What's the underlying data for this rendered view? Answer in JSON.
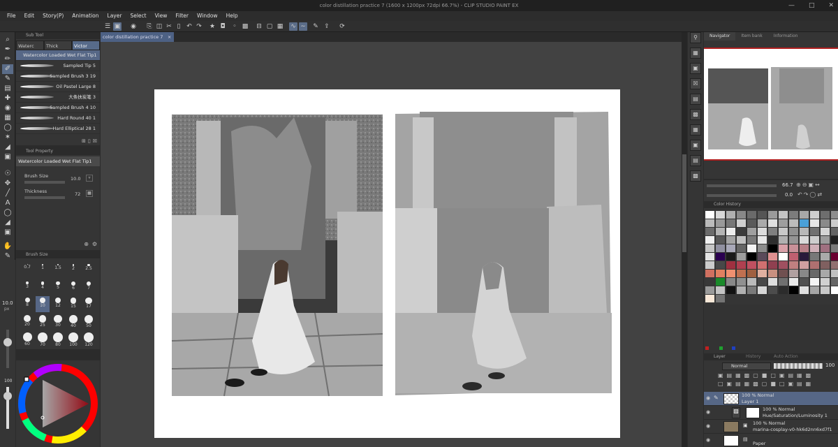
{
  "window": {
    "title": "color distillation practice 7 (1600 x 1200px 72dpi 66.7%) - CLIP STUDIO PAINT EX"
  },
  "menu": [
    "File",
    "Edit",
    "Story(P)",
    "Animation",
    "Layer",
    "Select",
    "View",
    "Filter",
    "Window",
    "Help"
  ],
  "subtool": {
    "header": "Sub Tool",
    "tabs": [
      "Waterc",
      "Thick",
      "Victor"
    ],
    "brushes": [
      "Watercolor Loaded Wet Flat Tip1",
      "Sampled Tip 5",
      "Sampled Brush 3 19",
      "Oil Pastel Large 8",
      "大条扶炭笔 3",
      "Sampled Brush 4 10",
      "Hard Round 40 1",
      "Hard Elliptical 28 1"
    ]
  },
  "tool_property": {
    "header": "Tool Property",
    "brush_name": "Watercolor Loaded Wet Flat Tip1",
    "brush_size_label": "Brush Size",
    "brush_size_value": "10.0",
    "thickness_label": "Thickness",
    "thickness_value": "72"
  },
  "brush_size": {
    "header": "Brush Size",
    "sizes": [
      "0.7",
      "1",
      "1.5",
      "2",
      "2.5",
      "3",
      "4",
      "5",
      "6",
      "7",
      "8",
      "10",
      "12",
      "15",
      "17",
      "20",
      "25",
      "30",
      "40",
      "50",
      "60",
      "70",
      "80",
      "100",
      "120"
    ],
    "selected": "10"
  },
  "left_strip": {
    "size_value": "10.0",
    "size_unit": "px",
    "opacity": "100"
  },
  "document_tab": {
    "label": "color distillation practice 7"
  },
  "navigator": {
    "tabs": [
      "Navigator",
      "Item bank",
      "Information"
    ],
    "zoom": "66.7",
    "rotation": "0.0"
  },
  "color_history": {
    "header": "Color History",
    "swatches": [
      "#ffffff",
      "#d8d8d8",
      "#b0b0b0",
      "#888888",
      "#6a6a6a",
      "#555555",
      "#9a9a9a",
      "#c4c4c4",
      "#7c7c7c",
      "#a8a8a8",
      "#cfcfcf",
      "#6e6e6e",
      "#8e8e8e",
      "#bbbbbb",
      "#999999",
      "#777777",
      "#d0d0d0",
      "#5a5a5a",
      "#aaaaaa",
      "#e0e0e0",
      "#9e9e9e",
      "#bcbcbc",
      "#4aa0d8",
      "#e6e6e6",
      "#8a8a8a",
      "#cccccc",
      "#6c6c6c",
      "#b4b4b4",
      "#ededed",
      "#3c3c3c",
      "#a0a0a0",
      "#dcdcdc",
      "#808080",
      "#c8c8c8",
      "#909090",
      "#b8b8b8",
      "#707070",
      "#d4d4d4",
      "#646464",
      "#f0f0f0",
      "#585858",
      "#a4a4a4",
      "#c0c0c0",
      "#7a7a7a",
      "#e8e8e8",
      "#2e2e2e",
      "#b0b0b0",
      "#949494",
      "#dadada",
      "#cecece",
      "#9c9c9c",
      "#202020",
      "#c6c6c6",
      "#9090a0",
      "#a8a8b8",
      "#666666",
      "#f4f4f4",
      "#8c8c8c",
      "#000000",
      "#d8a0a8",
      "#c89098",
      "#b88088",
      "#d0b0b8",
      "#a07080",
      "#7a7a7a",
      "#e4e4e4",
      "#2a0050",
      "#1a1a1a",
      "#9e9e9e",
      "#000000",
      "#5a4a5a",
      "#e09090",
      "#ffffff",
      "#c06070",
      "#2a1a3a",
      "#787878",
      "#aaaaaa",
      "#6a0030",
      "#cccccc",
      "#484848",
      "#a03040",
      "#b04050",
      "#c05060",
      "#d07070",
      "#904050",
      "#a05060",
      "#c08080",
      "#d0a0a0",
      "#b07070",
      "#806060",
      "#907070",
      "#d07060",
      "#e08060",
      "#f09070",
      "#c07050",
      "#a06040",
      "#e0b0a0",
      "#c89080",
      "#705050",
      "#b0a0a0",
      "#888888",
      "#686868",
      "#a8a8a8",
      "#c0c0c0",
      "#383838",
      "#1a8a2a",
      "#888888",
      "#909090",
      "#bababa",
      "#484848",
      "#dddddd",
      "#707070",
      "#e8e8e8",
      "#505050",
      "#f4f4f4",
      "#d0d0d0",
      "#666666",
      "#9a9a9a",
      "#c4c4c4",
      "#121212",
      "#b0b0b0",
      "#7a7a7a",
      "#d6d6d6",
      "#4c4c4c",
      "#2c2c2c",
      "#000000",
      "#e0e0e0",
      "#a6a6a6",
      "#c8c8c8",
      "#ffffff",
      "#f8e8d8",
      "#747474"
    ]
  },
  "layers": {
    "header": "Layer",
    "tabs": [
      "History",
      "Auto Action"
    ],
    "blend": "Normal",
    "opacity": "100",
    "items": [
      {
        "line1": "100 % Normal",
        "line2": "Layer 1"
      },
      {
        "line1": "100 % Normal",
        "line2": "Hue/Saturation/Luminosity 1"
      },
      {
        "line1": "100 % Normal",
        "line2": "marina-cosplay-v0-hk6d2nn6xd7f1"
      },
      {
        "line1": "",
        "line2": "Paper"
      }
    ]
  },
  "colors": {
    "accent": "#566786",
    "brand_red": "#b02020"
  }
}
